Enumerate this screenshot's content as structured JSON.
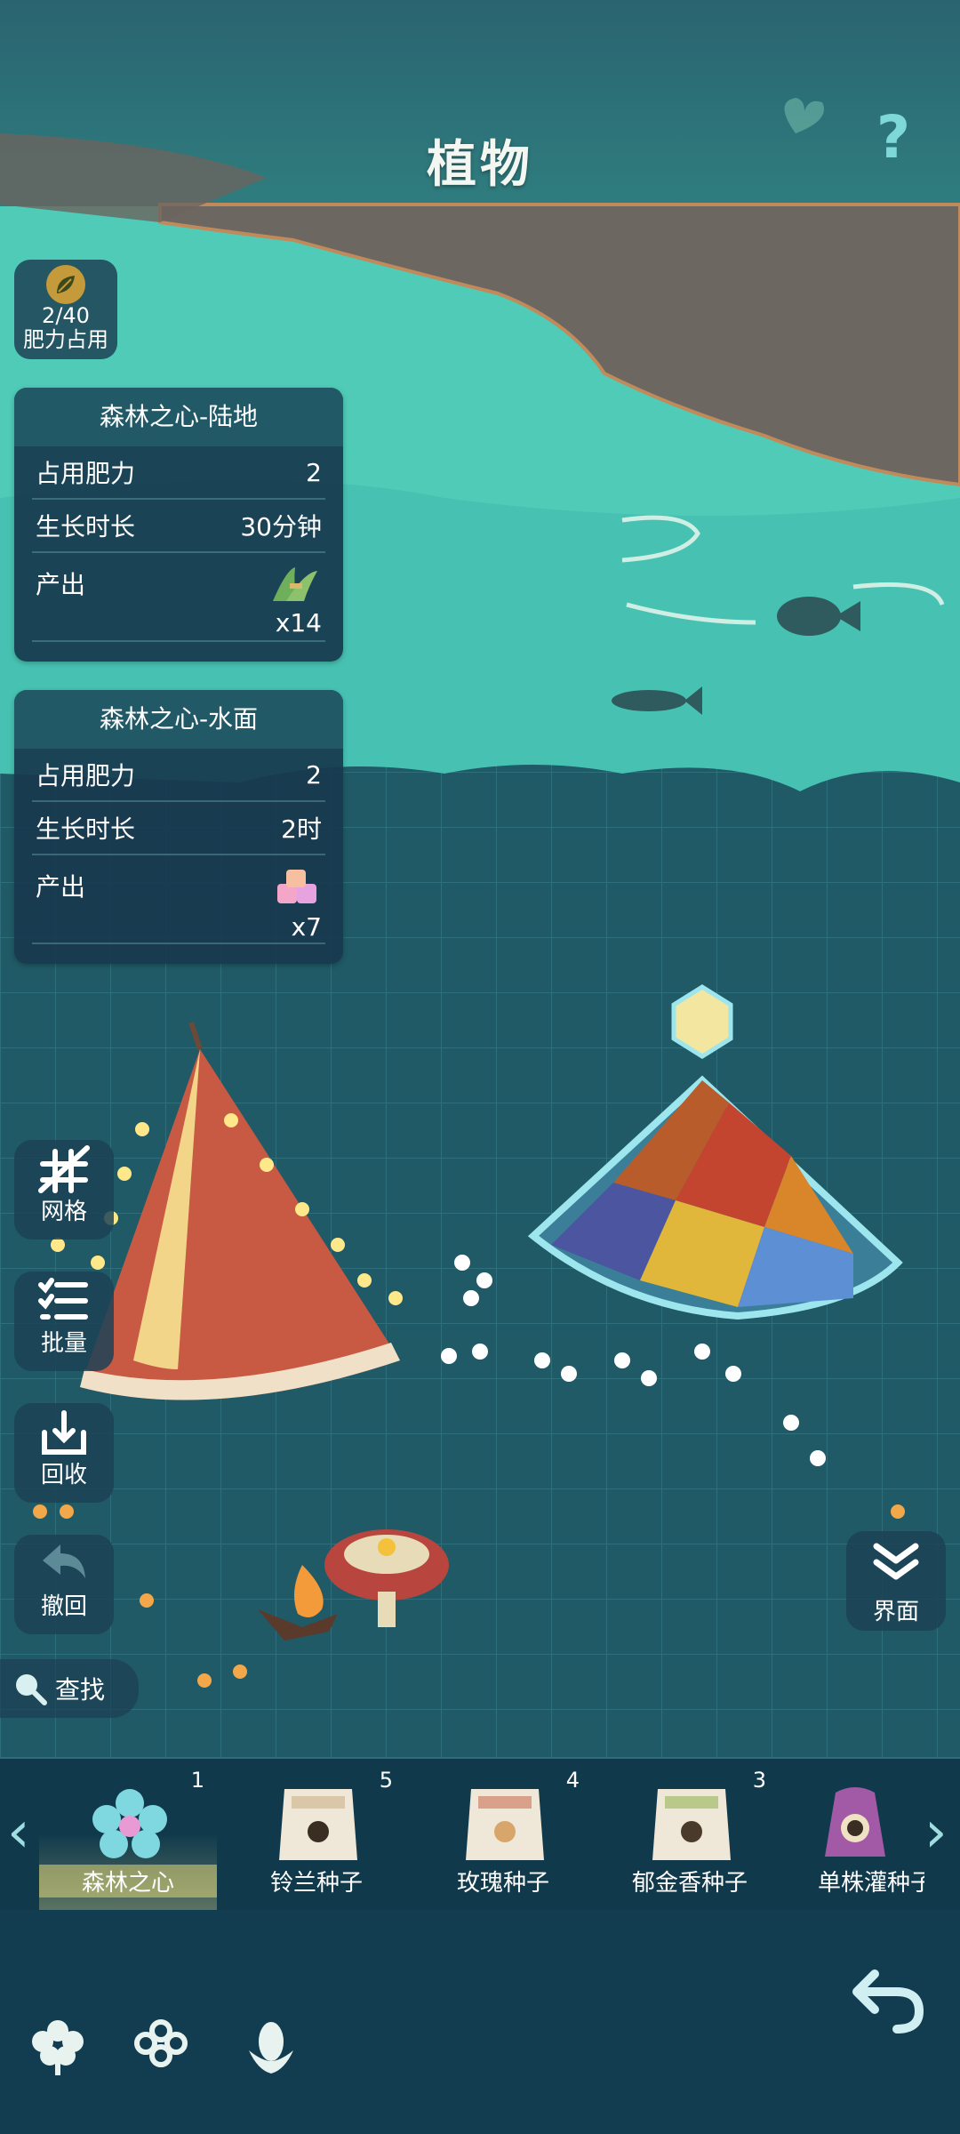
{
  "header": {
    "title": "植物",
    "help_icon": "?"
  },
  "fertilizer": {
    "value": "2/40",
    "label": "肥力占用",
    "icon": "leaf-icon"
  },
  "cards": [
    {
      "title": "森林之心-陆地",
      "rows": [
        {
          "label": "占用肥力",
          "value": "2"
        },
        {
          "label": "生长时长",
          "value": "30分钟"
        }
      ],
      "output_label": "产出",
      "output_item": "grass-bundle-icon",
      "output_qty": "x14"
    },
    {
      "title": "森林之心-水面",
      "rows": [
        {
          "label": "占用肥力",
          "value": "2"
        },
        {
          "label": "生长时长",
          "value": "2时"
        }
      ],
      "output_label": "产出",
      "output_item": "pink-cubes-icon",
      "output_qty": "x7"
    }
  ],
  "side_buttons": [
    {
      "label": "网格",
      "icon": "grid-toggle-icon"
    },
    {
      "label": "批量",
      "icon": "batch-list-icon"
    },
    {
      "label": "回收",
      "icon": "recycle-icon"
    },
    {
      "label": "撤回",
      "icon": "undo-icon"
    }
  ],
  "right_button": {
    "label": "界面",
    "icon": "double-chevron-down-icon"
  },
  "search": {
    "label": "查找"
  },
  "seeds": [
    {
      "name": "森林之心",
      "count": "1",
      "selected": true,
      "color": "#7fd7e0"
    },
    {
      "name": "铃兰种子",
      "count": "5",
      "color": "#d9c7a8"
    },
    {
      "name": "玫瑰种子",
      "count": "4",
      "color": "#d9a08a"
    },
    {
      "name": "郁金香种子",
      "count": "3",
      "color": "#b8c98a"
    },
    {
      "name": "单株灌种子",
      "count": "",
      "color": "#a25aa6"
    }
  ],
  "colors": {
    "panel": "#18384e",
    "water": "#49c8b6",
    "grid": "#24606d"
  }
}
